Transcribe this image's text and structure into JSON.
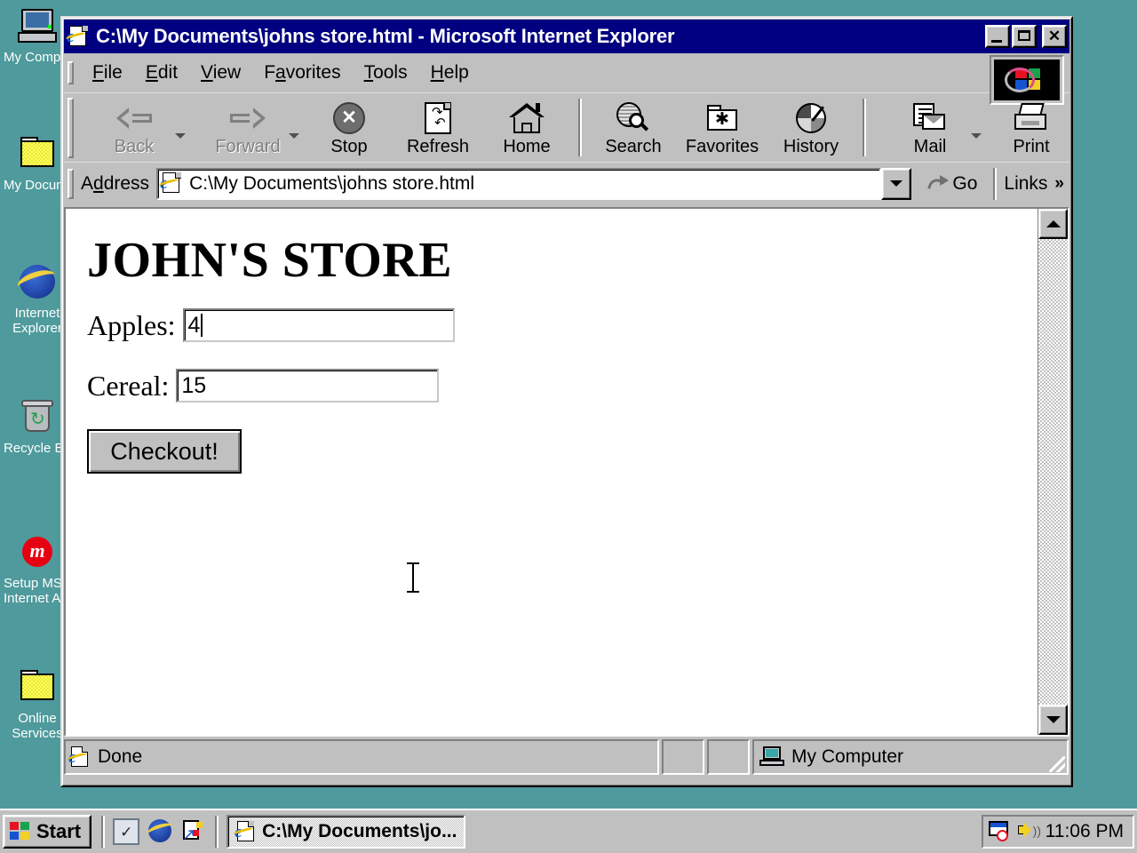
{
  "desktop": {
    "icons": [
      {
        "name": "my-computer",
        "label": "My Computer",
        "icon": "computer-icon"
      },
      {
        "name": "my-documents",
        "label": "My Documents",
        "icon": "folder-icon"
      },
      {
        "name": "internet-explorer",
        "label": "Internet\nExplorer",
        "icon": "ie-icon"
      },
      {
        "name": "recycle-bin",
        "label": "Recycle Bin",
        "icon": "recycle-bin-icon"
      },
      {
        "name": "setup-msn",
        "label": "Setup MSN\nInternet Access",
        "icon": "msn-icon"
      },
      {
        "name": "online-services",
        "label": "Online\nServices",
        "icon": "folder-icon"
      }
    ]
  },
  "window": {
    "title": "C:\\My Documents\\johns store.html - Microsoft Internet Explorer",
    "title_icon": "page-icon",
    "buttons": {
      "minimize": "Minimize",
      "maximize": "Maximize",
      "close": "Close"
    }
  },
  "menu": {
    "items": [
      {
        "label": "File",
        "accel": "F"
      },
      {
        "label": "Edit",
        "accel": "E"
      },
      {
        "label": "View",
        "accel": "V"
      },
      {
        "label": "Favorites",
        "accel": "a"
      },
      {
        "label": "Tools",
        "accel": "T"
      },
      {
        "label": "Help",
        "accel": "H"
      }
    ]
  },
  "toolbar": {
    "back": "Back",
    "forward": "Forward",
    "stop": "Stop",
    "refresh": "Refresh",
    "home": "Home",
    "search": "Search",
    "favorites": "Favorites",
    "history": "History",
    "mail": "Mail",
    "print": "Print"
  },
  "address": {
    "label": "Address",
    "value": "C:\\My Documents\\johns store.html",
    "go": "Go",
    "links": "Links",
    "links_chevron": "»"
  },
  "page": {
    "heading": "JOHN'S STORE",
    "fields": [
      {
        "name": "apples",
        "label": "Apples:",
        "value": "4",
        "focused": true
      },
      {
        "name": "cereal",
        "label": "Cereal:",
        "value": "15",
        "focused": false
      }
    ],
    "submit_label": "Checkout!"
  },
  "status": {
    "text": "Done",
    "zone": "My Computer"
  },
  "taskbar": {
    "start": "Start",
    "quicklaunch": [
      {
        "name": "show-desktop",
        "icon": "show-desktop-icon"
      },
      {
        "name": "launch-ie",
        "icon": "ie-icon"
      },
      {
        "name": "launch-outlook-express",
        "icon": "mail-icon"
      }
    ],
    "task": "C:\\My Documents\\jo...",
    "tray": {
      "icons": [
        "scheduled-tasks-icon",
        "volume-icon"
      ],
      "time": "11:06 PM"
    }
  },
  "colors": {
    "desktop": "#4f9a9c",
    "titlebar": "#000080",
    "face": "#c0c0c0",
    "page_bg": "#ffffff"
  }
}
